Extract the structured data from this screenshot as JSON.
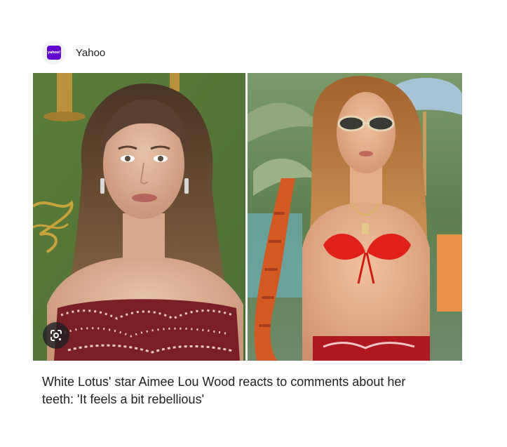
{
  "source": {
    "name": "Yahoo",
    "logo_text": "yahoo!",
    "brand_color": "#6001d2"
  },
  "image": {
    "left_alt": "Aimee Lou Wood red carpet portrait",
    "right_alt": "Aimee Lou Wood in red bikini scene",
    "lens_icon": "google-lens-icon"
  },
  "article": {
    "headline": "White Lotus' star Aimee Lou Wood reacts to comments about her teeth: 'It feels a bit rebellious'"
  }
}
